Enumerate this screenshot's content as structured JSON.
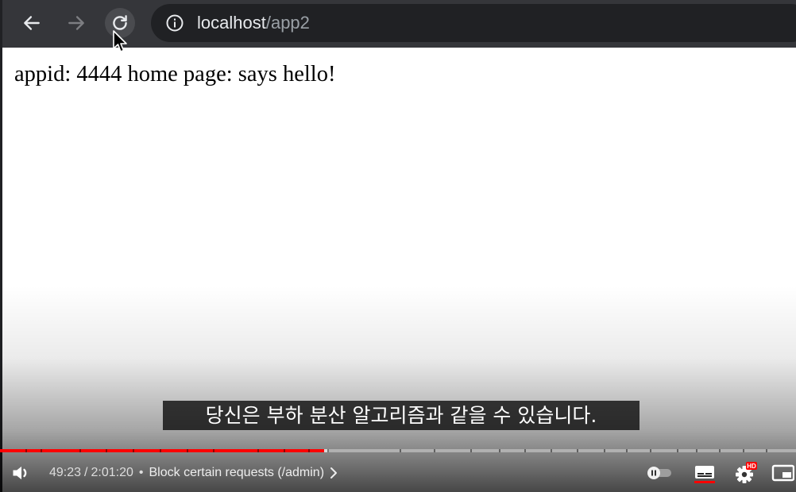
{
  "browser": {
    "url_host": "localhost",
    "url_path": "/app2",
    "icons": {
      "back": "arrow-left-icon",
      "forward": "arrow-right-icon",
      "reload": "reload-icon",
      "info": "info-icon",
      "cursor": "mouse-cursor-icon"
    }
  },
  "page": {
    "text": "appid: 4444 home page: says hello!"
  },
  "player": {
    "caption": "당신은 부하 분산 알고리즘과 같을 수 있습니다.",
    "current_time": "49:23",
    "time_separator": "/",
    "duration": "2:01:20",
    "bullet": "•",
    "chapter": "Block certain requests (/admin)",
    "progress_fraction": 0.4069,
    "buffered_fraction": 0.413,
    "settings_badge": "HD",
    "accent_color": "#ff0000",
    "icons": {
      "volume": "volume-icon",
      "chapter_chevron": "chevron-right-icon",
      "autoplay": "autoplay-toggle-icon",
      "subtitles": "subtitles-icon",
      "settings": "settings-gear-icon",
      "miniplayer": "miniplayer-icon"
    }
  }
}
